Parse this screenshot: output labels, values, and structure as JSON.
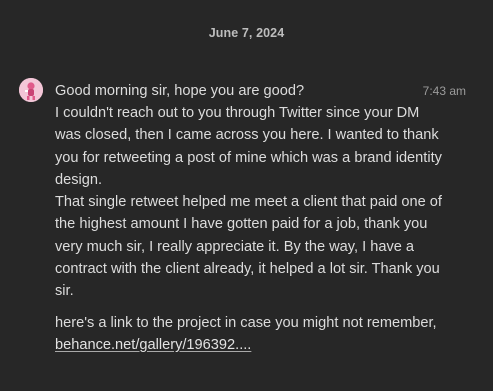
{
  "date_separator": "June 7, 2024",
  "message": {
    "timestamp": "7:43 am",
    "lines": [
      "Good morning sir, hope you are good?",
      "I couldn't reach out to you through Twitter since your DM",
      "was closed, then I came across you here. I wanted to thank",
      "you for retweeting a post of mine which was a brand identity",
      "design.",
      "That single retweet helped me meet a client that paid one of",
      "the highest amount I have gotten paid for a job, thank you",
      "very much sir, I really appreciate it. By the way, I have a",
      "contract with the client already, it helped a lot sir. Thank you",
      "sir."
    ],
    "followup_text": "here's a link to the project in case you might not remember,",
    "link_text": "behance.net/gallery/196392...."
  },
  "colors": {
    "background": "#272727",
    "text": "#dcdcdc",
    "muted": "#9b9b9b",
    "avatar_bg": "#f3c6d7"
  },
  "icons": {
    "avatar": "user-avatar-pink"
  }
}
